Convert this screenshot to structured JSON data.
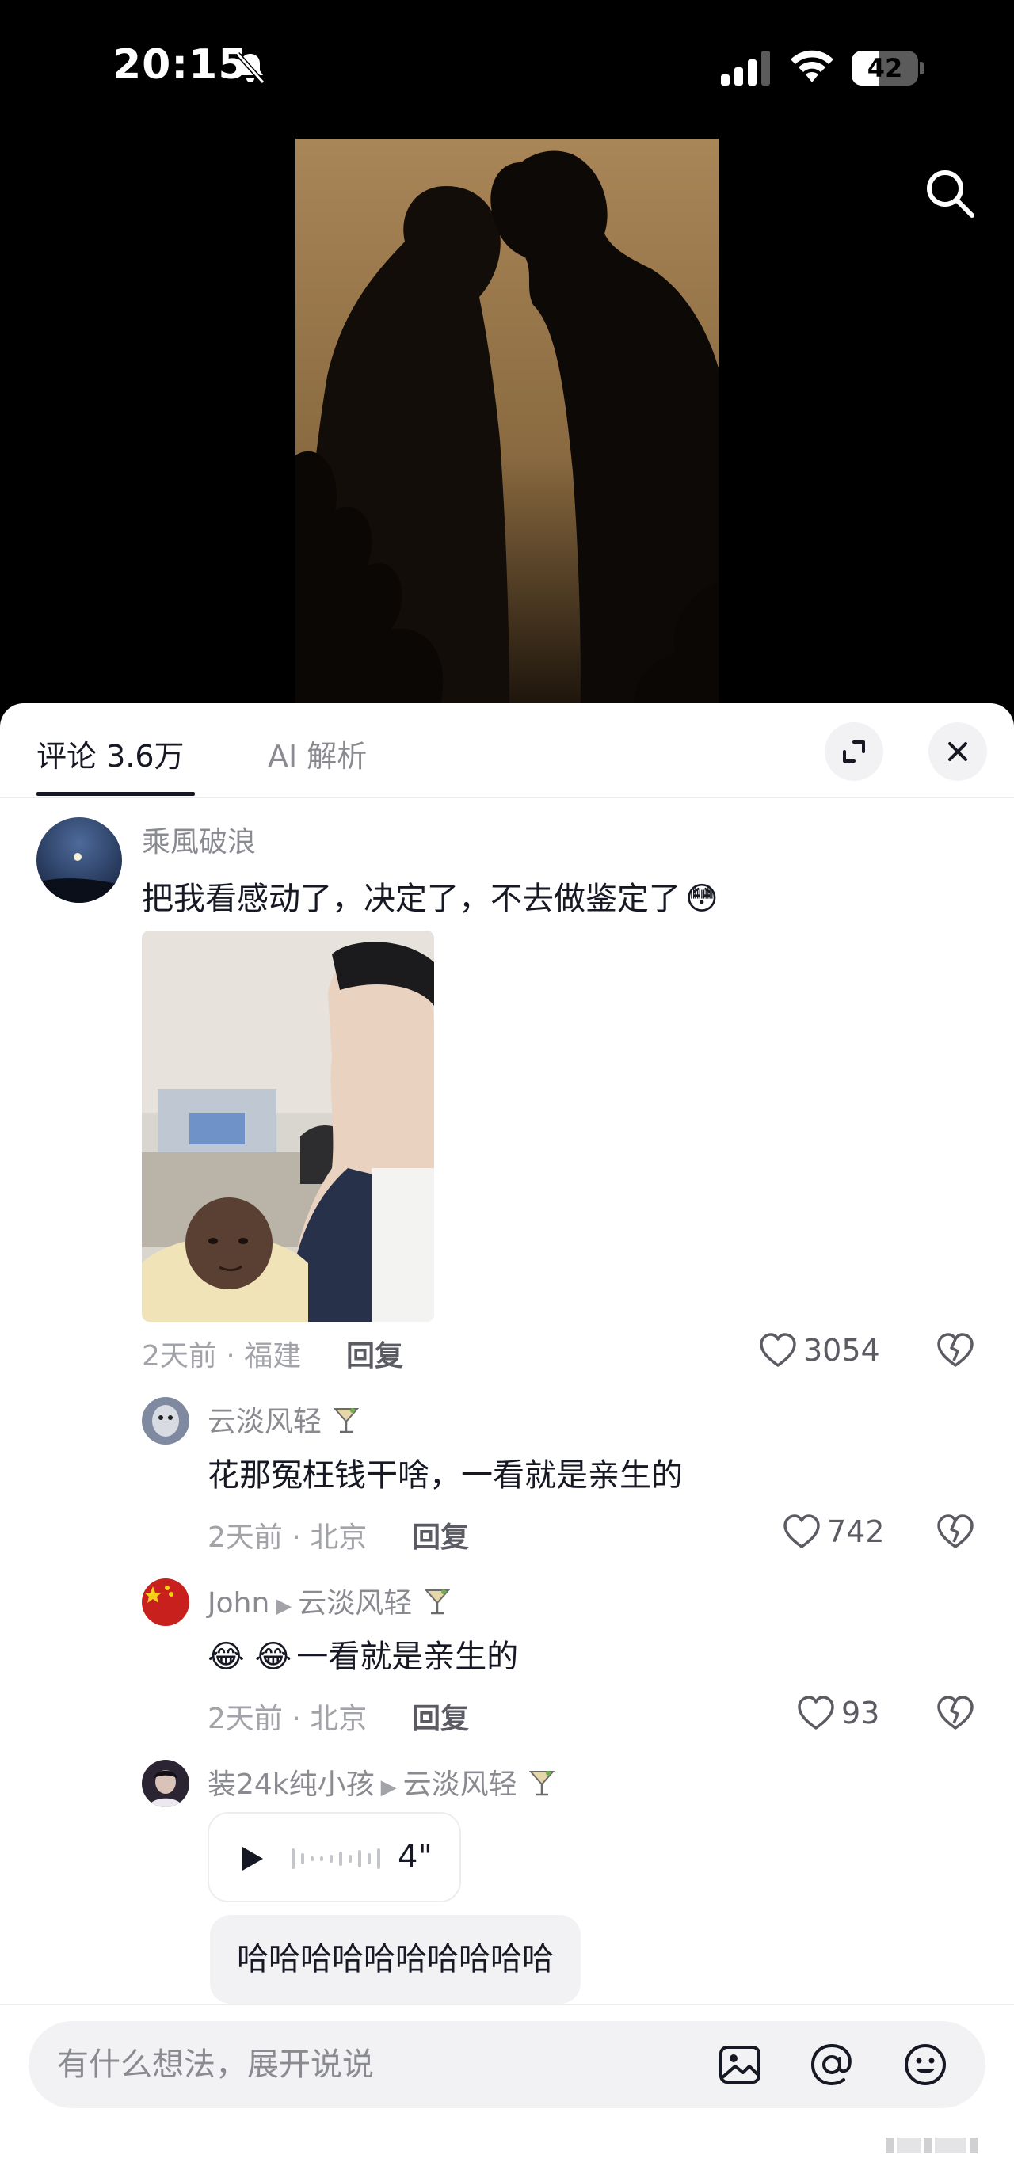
{
  "status_bar": {
    "time": "20:15",
    "battery": "42",
    "battery_level": 0.42
  },
  "tabs": [
    {
      "label": "评论 3.6万",
      "active": true
    },
    {
      "label": "AI 解析",
      "active": false
    }
  ],
  "comments": [
    {
      "user": "乘風破浪",
      "text": "把我看感动了，决定了，不去做鉴定了",
      "emoji": "😳",
      "meta": "2天前 · 福建",
      "reply": "回复",
      "likes": "3054"
    }
  ],
  "replies": [
    {
      "user": "云淡风轻",
      "text": "花那冤枉钱干啥，一看就是亲生的",
      "meta": "2天前 · 北京",
      "reply": "回复",
      "likes": "742"
    },
    {
      "user": "John",
      "reply_to": "云淡风轻",
      "emoji": "😂 😂",
      "text": "一看就是亲生的",
      "meta": "2天前 · 北京",
      "reply": "回复",
      "likes": "93"
    },
    {
      "user": "装24k纯小孩",
      "reply_to": "云淡风轻",
      "voice_duration": "4\"",
      "transcript": "哈哈哈哈哈哈哈哈哈哈"
    }
  ],
  "input": {
    "placeholder": "有什么想法，展开说说"
  },
  "icons": {
    "search": "search-icon",
    "expand": "expand-icon",
    "close": "close-icon",
    "like": "heart-icon",
    "dislike": "broken-heart-icon",
    "image": "image-icon",
    "at": "at-icon",
    "emoji": "emoji-icon"
  },
  "colors": {
    "text_primary": "#161823",
    "text_secondary": "#8a8b91",
    "surface": "#f2f2f4"
  }
}
